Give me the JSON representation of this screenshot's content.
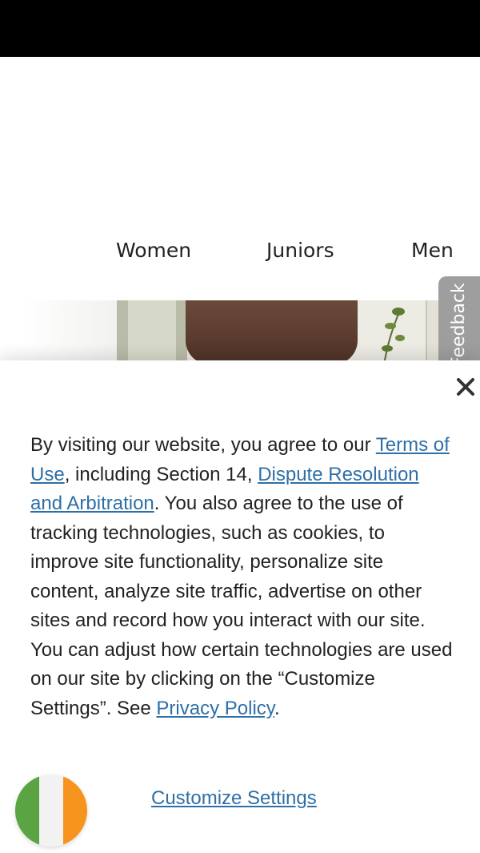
{
  "nav": {
    "items": [
      {
        "label": "Women"
      },
      {
        "label": "Juniors"
      },
      {
        "label": "Men"
      }
    ]
  },
  "feedback": {
    "label": "Feedback"
  },
  "consent": {
    "segments": [
      {
        "text": "By visiting our website, you agree to our ",
        "link": false
      },
      {
        "text": "Terms of Use",
        "link": true
      },
      {
        "text": ", including Section 14, ",
        "link": false
      },
      {
        "text": "Dispute Resolution and Arbitration",
        "link": true
      },
      {
        "text": ". You also agree to the use of tracking technologies, such as cookies, to improve site functionality, personalize site content, analyze site traffic, advertise on other sites and record how you interact with our site. You can adjust how certain technologies are used on our site by clicking on the “Customize Settings”. See ",
        "link": false
      },
      {
        "text": "Privacy Policy",
        "link": true
      },
      {
        "text": ".",
        "link": false
      }
    ],
    "customize_label": "Customize Settings",
    "close_icon": "close-icon"
  },
  "flag": {
    "icon": "ireland-flag-icon",
    "colors": [
      "#5aa444",
      "#f2f2f2",
      "#f7941d"
    ]
  },
  "colors": {
    "link": "#2f6fa6",
    "status_bar": "#000000",
    "feedback_tab": "#9e9e9e"
  }
}
